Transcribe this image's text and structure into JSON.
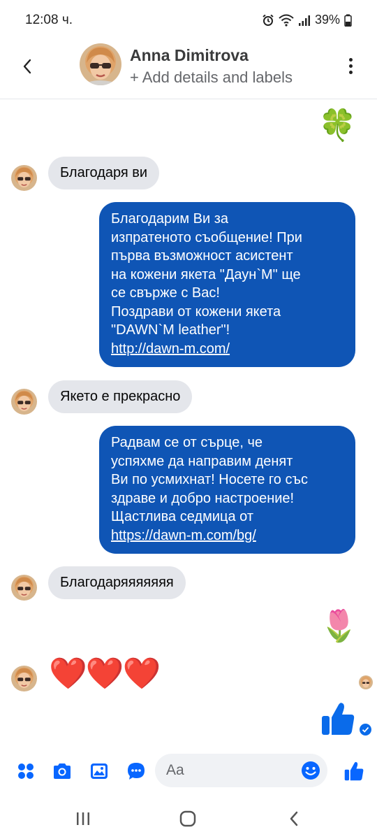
{
  "status": {
    "time": "12:08 ч.",
    "battery": "39%",
    "icons": [
      "alarm-icon",
      "wifi-icon",
      "signal-icon",
      "battery-icon"
    ]
  },
  "header": {
    "contact_name": "Anna Dimitrova",
    "subtitle": "+ Add details and labels",
    "back_icon": "chevron-left-icon",
    "more_icon": "more-vertical-icon"
  },
  "messages": [
    {
      "from": "me",
      "type": "emoji",
      "content": "🍀"
    },
    {
      "from": "them",
      "type": "text",
      "content": "Благодаря ви"
    },
    {
      "from": "me",
      "type": "text",
      "lines": [
        "Благодарим Ви за",
        "изпратеното съобщение! При",
        "първа възможност асистент",
        "на кожени якета \"Даун`М\" ще",
        "се свърже с Вас!",
        "Поздрави от кожени якета",
        "\"DAWN`M leather\"!"
      ],
      "link": "http://dawn-m.com/"
    },
    {
      "from": "them",
      "type": "text",
      "content": "Якето е прекрасно"
    },
    {
      "from": "me",
      "type": "text",
      "lines": [
        "Радвам се от сърце, че",
        "успяхме да направим денят",
        "Ви по усмихнат! Носете го със",
        "здраве и добро настроение!",
        "Щастлива седмица от"
      ],
      "link": "https://dawn-m.com/bg/"
    },
    {
      "from": "them",
      "type": "text",
      "content": "Благодаряяяяяяя"
    },
    {
      "from": "me",
      "type": "emoji",
      "content": "🌷"
    },
    {
      "from": "them",
      "type": "emoji",
      "content": "❤️❤️❤️"
    },
    {
      "from": "me",
      "type": "like",
      "content": "thumbs-up-icon",
      "status": "sent-check-icon"
    }
  ],
  "composer": {
    "placeholder": "Aa",
    "icons": [
      "apps-grid-icon",
      "camera-icon",
      "gallery-icon",
      "chat-bubble-icon",
      "emoji-smile-icon",
      "like-button-icon"
    ]
  },
  "navbar": {
    "icons": [
      "recent-apps-icon",
      "home-icon",
      "back-icon"
    ]
  },
  "colors": {
    "accent": "#0866ff",
    "outgoing_bubble": "#0f55b5",
    "incoming_bubble": "#e4e6eb"
  }
}
